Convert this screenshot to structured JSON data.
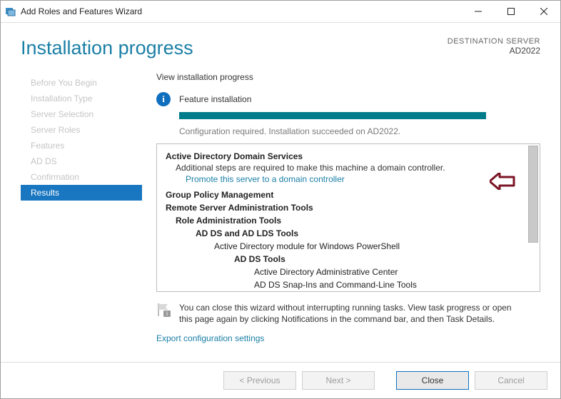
{
  "window": {
    "title": "Add Roles and Features Wizard"
  },
  "header": {
    "heading": "Installation progress",
    "destination_label": "DESTINATION SERVER",
    "destination_name": "AD2022"
  },
  "sidebar": {
    "items": [
      "Before You Begin",
      "Installation Type",
      "Server Selection",
      "Server Roles",
      "Features",
      "AD DS",
      "Confirmation",
      "Results"
    ],
    "active_index": 7
  },
  "pane": {
    "subtitle": "View installation progress",
    "status": "Feature installation",
    "config_text": "Configuration required. Installation succeeded on AD2022.",
    "results": {
      "adds_title": "Active Directory Domain Services",
      "adds_note": "Additional steps are required to make this machine a domain controller.",
      "adds_link": "Promote this server to a domain controller",
      "gpm": "Group Policy Management",
      "rsat": "Remote Server Administration Tools",
      "role_admin": "Role Administration Tools",
      "adds_lds": "AD DS and AD LDS Tools",
      "ad_module": "Active Directory module for Windows PowerShell",
      "adds_tools": "AD DS Tools",
      "adac": "Active Directory Administrative Center",
      "snapins": "AD DS Snap-Ins and Command-Line Tools"
    },
    "footer_note": "You can close this wizard without interrupting running tasks. View task progress or open this page again by clicking Notifications in the command bar, and then Task Details.",
    "export_link": "Export configuration settings"
  },
  "buttons": {
    "previous": "< Previous",
    "next": "Next >",
    "close": "Close",
    "cancel": "Cancel"
  }
}
